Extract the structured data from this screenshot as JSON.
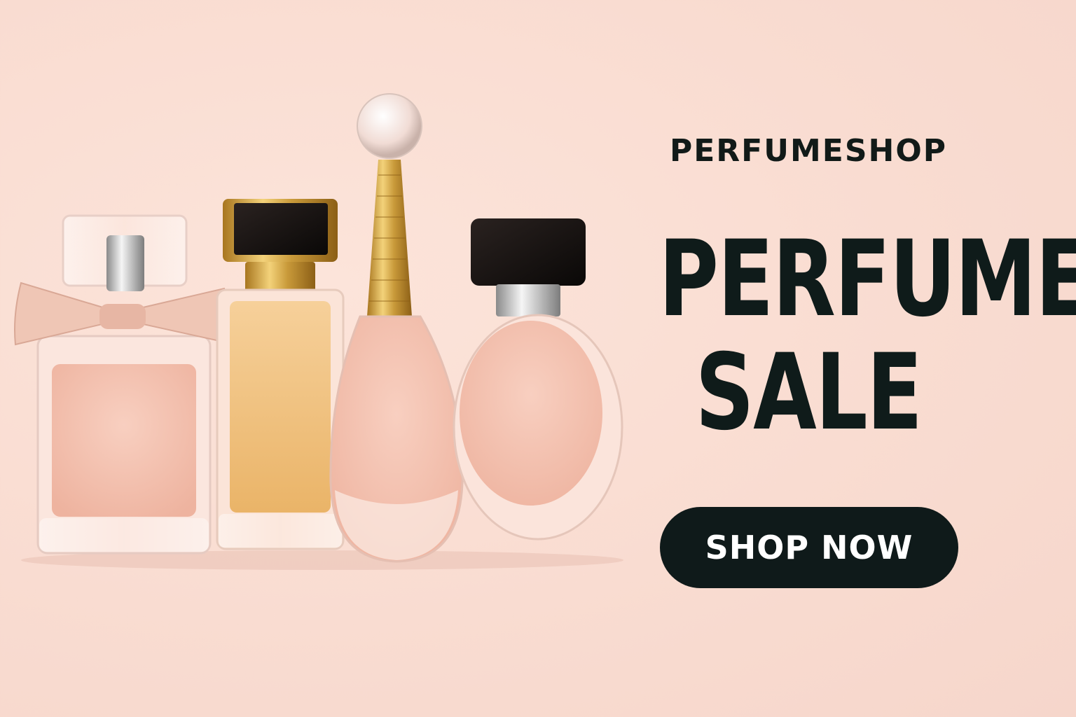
{
  "brand": {
    "name": "PERFUMESHOP"
  },
  "headline": {
    "line1": "PERFUME",
    "line2": "SALE"
  },
  "cta": {
    "label": "SHOP NOW"
  },
  "colors": {
    "background": "#f9dcd1",
    "text": "#0f1b1a",
    "button": "#0f1a1a",
    "button_text": "#ffffff",
    "gold": "#c99a3a"
  },
  "bottles": [
    {
      "name": "bow-bottle",
      "liquid": "#f3c0ad",
      "cap": "clear glass"
    },
    {
      "name": "rectangle-gold-bottle",
      "liquid": "#f2c483",
      "cap": "black and gold"
    },
    {
      "name": "teardrop-bottle",
      "liquid": "#f5c2b3",
      "cap": "gold coil with glass sphere"
    },
    {
      "name": "oval-bottle",
      "liquid": "#f3c1ae",
      "cap": "black"
    }
  ]
}
